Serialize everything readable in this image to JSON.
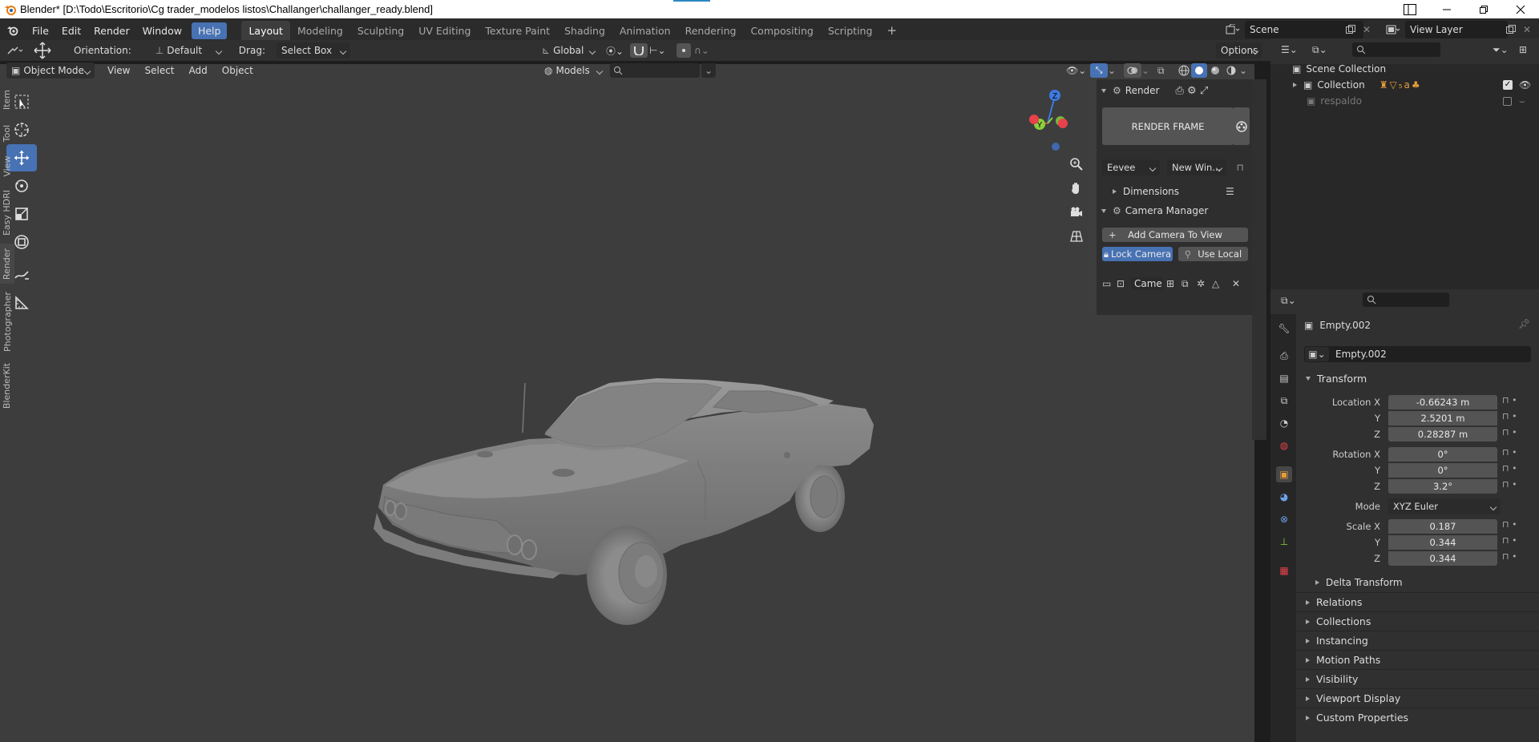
{
  "window": {
    "title": "Blender* [D:\\Todo\\Escritorio\\Cg trader_modelos listos\\Challanger\\challanger_ready.blend]"
  },
  "menu": {
    "items": [
      "File",
      "Edit",
      "Render",
      "Window",
      "Help"
    ],
    "active": "Help"
  },
  "workspaces": {
    "tabs": [
      "Layout",
      "Modeling",
      "Sculpting",
      "UV Editing",
      "Texture Paint",
      "Shading",
      "Animation",
      "Rendering",
      "Compositing",
      "Scripting"
    ],
    "active": "Layout"
  },
  "scene": {
    "name": "Scene",
    "view_layer": "View Layer"
  },
  "tool_header": {
    "orientation_label": "Orientation:",
    "orientation_value": "Default",
    "drag_label": "Drag:",
    "drag_value": "Select Box",
    "transform_space": "Global",
    "options_label": "Options"
  },
  "viewport_header": {
    "mode": "Object Mode",
    "menus": [
      "View",
      "Select",
      "Add",
      "Object"
    ],
    "asset_lib": "Models"
  },
  "gizmo": {
    "axes": [
      "Z",
      "Y",
      "X"
    ]
  },
  "npanel": {
    "render_header": "Render",
    "render_frame_label": "RENDER FRAME",
    "engine": "Eevee",
    "window_mode": "New Win...",
    "dimensions_label": "Dimensions",
    "camera_manager_label": "Camera Manager",
    "add_camera_label": "Add Camera To View",
    "lock_camera_label": "Lock Camera",
    "use_local_label": "Use Local",
    "camera_field": "Came",
    "tabs": [
      "Item",
      "Tool",
      "View",
      "Easy HDRI",
      "Render",
      "Photographer",
      "BlenderKit"
    ],
    "active_tab": "Render"
  },
  "outliner": {
    "root": "Scene Collection",
    "items": [
      {
        "name": "Collection",
        "dimmed": false
      },
      {
        "name": "respaldo",
        "dimmed": true
      }
    ]
  },
  "properties": {
    "object_name": "Empty.002",
    "data_name": "Empty.002",
    "transform_label": "Transform",
    "location_labels": [
      "Location X",
      "Y",
      "Z"
    ],
    "location_values": [
      "-0.66243 m",
      "2.5201 m",
      "0.28287 m"
    ],
    "rotation_labels": [
      "Rotation X",
      "Y",
      "Z"
    ],
    "rotation_values": [
      "0°",
      "0°",
      "3.2°"
    ],
    "mode_label": "Mode",
    "mode_value": "XYZ Euler",
    "scale_labels": [
      "Scale X",
      "Y",
      "Z"
    ],
    "scale_values": [
      "0.187",
      "0.344",
      "0.344"
    ],
    "delta_transform_label": "Delta Transform",
    "sections": [
      "Relations",
      "Collections",
      "Instancing",
      "Motion Paths",
      "Visibility",
      "Viewport Display",
      "Custom Properties"
    ]
  },
  "colors": {
    "accent": "#4772b3",
    "viewport_bg": "#3d3d3d",
    "panel_bg": "#303030",
    "axis_x": "#e8414b",
    "axis_y": "#8ccf3c",
    "axis_z": "#3e7ae0"
  }
}
